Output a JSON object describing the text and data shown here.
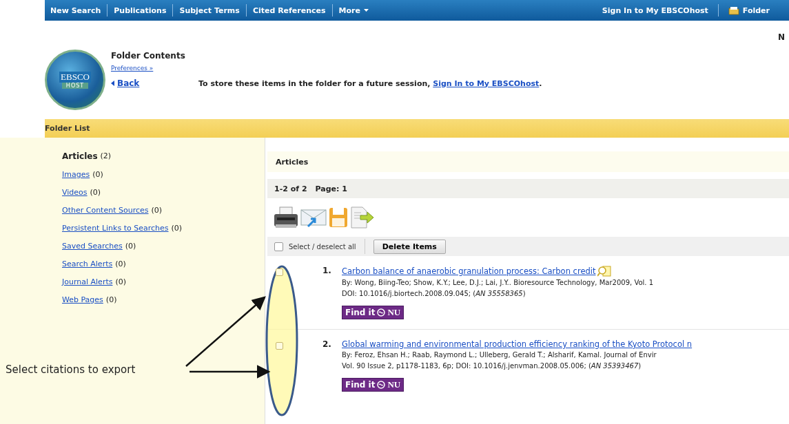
{
  "top_nav": {
    "items": [
      {
        "label": "New Search",
        "kind": "link"
      },
      {
        "label": "Publications",
        "kind": "link"
      },
      {
        "label": "Subject Terms",
        "kind": "link"
      },
      {
        "label": "Cited References",
        "kind": "link"
      },
      {
        "label": "More",
        "kind": "menu"
      }
    ],
    "sign_in": "Sign In to My EBSCOhost",
    "folder": "Folder"
  },
  "corner_text": "N",
  "logo": {
    "text": "EBSCO",
    "subtext": "HOST"
  },
  "header": {
    "title": "Folder Contents",
    "preferences": "Preferences »",
    "back": "Back",
    "message": "To store these items in the folder for a future session,",
    "message_link": "Sign In to My EBSCOhost",
    "message_end": "."
  },
  "folder_list": {
    "title": "Folder List"
  },
  "sidebar": {
    "items": [
      {
        "label": "Articles",
        "count": "(2)",
        "selected": true
      },
      {
        "label": "Images",
        "count": "(0)",
        "selected": false
      },
      {
        "label": "Videos",
        "count": "(0)",
        "selected": false
      },
      {
        "label": "Other Content Sources",
        "count": "(0)",
        "selected": false
      },
      {
        "label": "Persistent Links to Searches",
        "count": "(0)",
        "selected": false
      },
      {
        "label": "Saved Searches",
        "count": "(0)",
        "selected": false
      },
      {
        "label": "Search Alerts",
        "count": "(0)",
        "selected": false
      },
      {
        "label": "Journal Alerts",
        "count": "(0)",
        "selected": false
      },
      {
        "label": "Web Pages",
        "count": "(0)",
        "selected": false
      }
    ]
  },
  "content": {
    "heading": "Articles",
    "range": "1-2 of 2",
    "page": "Page: 1",
    "select_all": {
      "label": "Select / deselect all",
      "checked": false
    },
    "delete_button": "Delete Items",
    "results": [
      {
        "number": "1.",
        "title": "Carbon balance of anaerobic granulation process: Carbon credit",
        "has_preview": true,
        "checked": false,
        "lines": [
          "By: Wong, Biing-Teo; Show, K.Y.; Lee, D.J.; Lai, J.Y.. Bioresource Technology, Mar2009, Vol. 1",
          "DOI: 10.1016/j.biortech.2008.09.045; (*AN 35558365*)"
        ],
        "find_it": "Find it",
        "find_it_brand": "NU"
      },
      {
        "number": "2.",
        "title": "Global warming and environmental production efficiency ranking of the Kyoto Protocol n",
        "has_preview": false,
        "checked": false,
        "lines": [
          "By: Feroz, Ehsan H.; Raab, Raymond L.; Ulleberg, Gerald T.; Alsharif, Kamal. Journal of Envir",
          "Vol. 90 Issue 2, p1178-1183, 6p; DOI: 10.1016/j.jenvman.2008.05.006; (*AN 35393467*)"
        ],
        "find_it": "Find it",
        "find_it_brand": "NU"
      }
    ]
  },
  "annotation": {
    "text": "Select citations to export"
  }
}
